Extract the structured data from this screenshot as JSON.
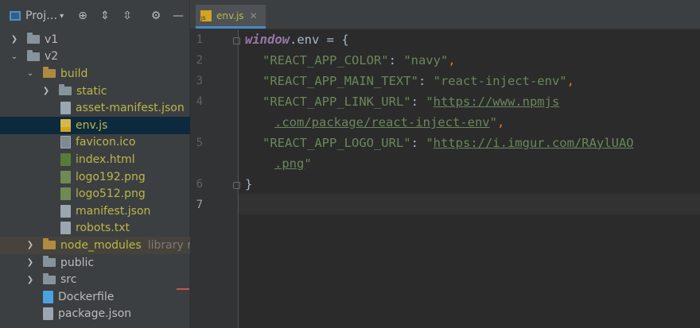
{
  "project": {
    "title": "Proj…",
    "tree": [
      {
        "label": "v1",
        "type": "folder",
        "expanded": false,
        "depth": 0
      },
      {
        "label": "v2",
        "type": "folder",
        "expanded": true,
        "depth": 0
      },
      {
        "label": "build",
        "type": "folder-orange",
        "expanded": true,
        "depth": 1
      },
      {
        "label": "static",
        "type": "folder",
        "expanded": false,
        "depth": 2
      },
      {
        "label": "asset-manifest.json",
        "type": "json",
        "depth": 2
      },
      {
        "label": "env.js",
        "type": "js",
        "depth": 2,
        "selected": true
      },
      {
        "label": "favicon.ico",
        "type": "ico",
        "depth": 2
      },
      {
        "label": "index.html",
        "type": "html",
        "depth": 2
      },
      {
        "label": "logo192.png",
        "type": "img",
        "depth": 2
      },
      {
        "label": "logo512.png",
        "type": "img",
        "depth": 2
      },
      {
        "label": "manifest.json",
        "type": "json",
        "depth": 2
      },
      {
        "label": "robots.txt",
        "type": "txt",
        "depth": 2
      },
      {
        "label": "node_modules",
        "suffix": "library ro",
        "type": "folder-orange",
        "expanded": false,
        "depth": 1,
        "excluded": true
      },
      {
        "label": "public",
        "type": "folder",
        "expanded": false,
        "depth": 1
      },
      {
        "label": "src",
        "type": "folder",
        "expanded": false,
        "depth": 1
      },
      {
        "label": "Dockerfile",
        "type": "docker",
        "depth": 1
      },
      {
        "label": "package.json",
        "type": "json",
        "depth": 1
      }
    ]
  },
  "editor": {
    "tab_label": "env.js",
    "line_numbers": [
      "1",
      "2",
      "3",
      "4",
      "5",
      "6",
      "7"
    ],
    "code": {
      "kw_window": "window",
      "l1_rest": ".env = {",
      "l2_key": "\"REACT_APP_COLOR\"",
      "l2_val": "\"navy\"",
      "l3_key": "\"REACT_APP_MAIN_TEXT\"",
      "l3_val": "\"react-inject-env\"",
      "l4_key": "\"REACT_APP_LINK_URL\"",
      "l4_q": "\"",
      "l4_url1": "https://www.npmjs",
      "l4b_url2": ".com/package/react-inject-env",
      "l4b_end": "\"",
      "l5_key": "\"REACT_APP_LOGO_URL\"",
      "l5_q": "\"",
      "l5_url1": "https://i.imgur.com/RAylUAO",
      "l5b_url2": ".png",
      "l5b_end": "\"",
      "colon": ": ",
      "comma": ",",
      "l6": "}"
    }
  }
}
